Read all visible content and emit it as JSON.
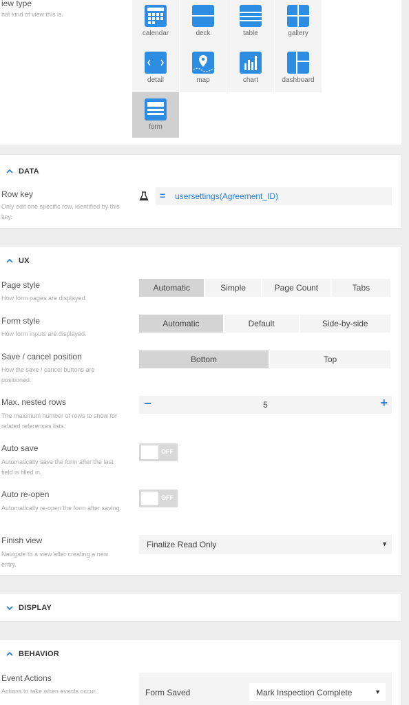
{
  "view_type": {
    "label": "iew type",
    "description": "hat kind of view this is.",
    "options": [
      "calendar",
      "deck",
      "table",
      "gallery",
      "detail",
      "map",
      "chart",
      "dashboard",
      "form"
    ],
    "selected": "form"
  },
  "data_section": {
    "title": "DATA",
    "row_key": {
      "label": "Row key",
      "description": "Only edit one specific row, identified by this key.",
      "operator": "=",
      "value": "usersettings(Agreement_ID)"
    }
  },
  "ux_section": {
    "title": "UX",
    "page_style": {
      "label": "Page style",
      "description": "How form pages are displayed.",
      "options": [
        "Automatic",
        "Simple",
        "Page Count",
        "Tabs"
      ],
      "selected": "Automatic"
    },
    "form_style": {
      "label": "Form style",
      "description": "How form inputs are displayed.",
      "options": [
        "Automatic",
        "Default",
        "Side-by-side"
      ],
      "selected": "Automatic"
    },
    "save_cancel": {
      "label": "Save / cancel position",
      "description": "How the save / cancel buttons are positioned.",
      "options": [
        "Bottom",
        "Top"
      ],
      "selected": "Bottom"
    },
    "nested_rows": {
      "label": "Max. nested rows",
      "description": "The maximum number of rows to show for related references lists.",
      "value": "5",
      "minus": "−",
      "plus": "+"
    },
    "auto_save": {
      "label": "Auto save",
      "description": "Automatically save the form after the last field is filled in.",
      "state": "OFF"
    },
    "auto_reopen": {
      "label": "Auto re-open",
      "description": "Automatically re-open the form after saving.",
      "state": "OFF"
    },
    "finish_view": {
      "label": "Finish view",
      "description": "Navigate to a view after creating a new entry.",
      "value": "Finalize Read Only",
      "arrow": "▼"
    }
  },
  "display_section": {
    "title": "DISPLAY"
  },
  "behavior_section": {
    "title": "BEHAVIOR",
    "event_actions": {
      "label": "Event Actions",
      "description": "Actions to take when events occur.",
      "event": "Form Saved",
      "action": "Mark Inspection Complete",
      "arrow": "▼"
    }
  },
  "colors": {
    "accent": "#2a7fd8",
    "icon_blue": "#2d8de3",
    "selected_tile": "#d0d0d0"
  }
}
